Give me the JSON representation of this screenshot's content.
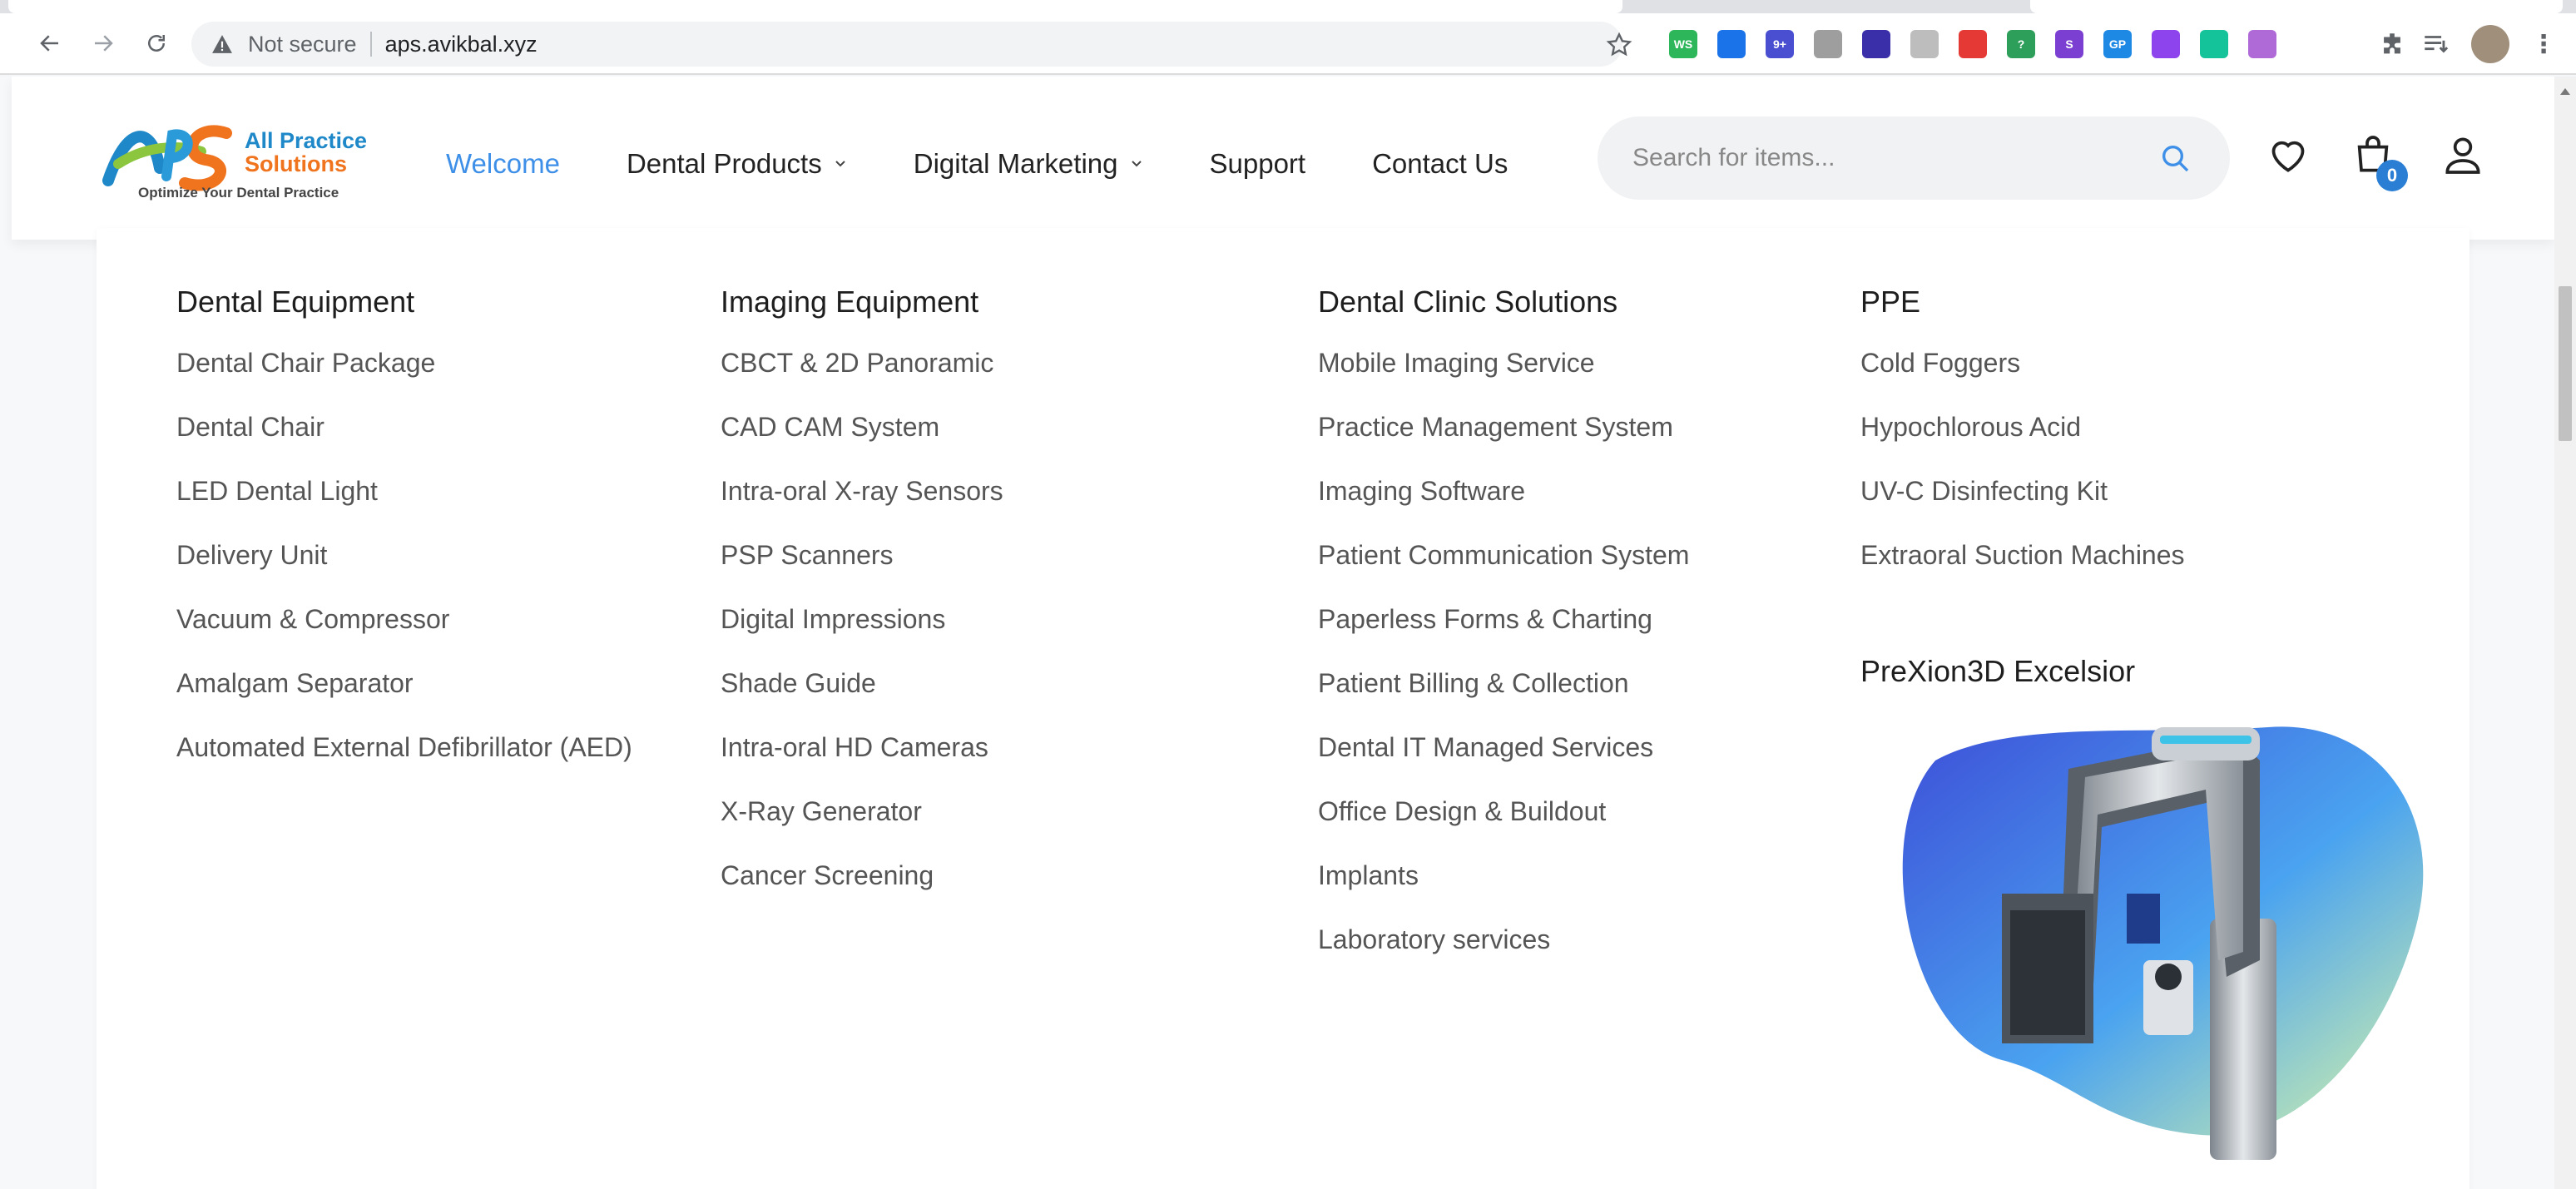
{
  "browser": {
    "security_label": "Not secure",
    "url": "aps.avikbal.xyz",
    "extensions": [
      {
        "name": "ws-extension",
        "label": "WS",
        "color": "#2eb65a"
      },
      {
        "name": "check-extension",
        "label": "",
        "color": "#1a73e8"
      },
      {
        "name": "badge-extension",
        "label": "9+",
        "color": "#4a4fd1"
      },
      {
        "name": "grey-extension",
        "label": "",
        "color": "#9e9e9e"
      },
      {
        "name": "s-extension",
        "label": "",
        "color": "#3a2fa8"
      },
      {
        "name": "grey2-extension",
        "label": "",
        "color": "#bdbdbd"
      },
      {
        "name": "o-extension",
        "label": "",
        "color": "#e53935"
      },
      {
        "name": "puzzle-badge-extension",
        "label": "?",
        "color": "#2e9e5b"
      },
      {
        "name": "s-purple-extension",
        "label": "S",
        "color": "#7b3fd1"
      },
      {
        "name": "gp-extension",
        "label": "GP",
        "color": "#1e88e5"
      },
      {
        "name": "tick-extension",
        "label": "",
        "color": "#8e44ec"
      },
      {
        "name": "grammarly-extension",
        "label": "",
        "color": "#15c39a"
      },
      {
        "name": "pen-extension",
        "label": "",
        "color": "#b06ad8"
      }
    ]
  },
  "brand": {
    "name_line1": "All Practice",
    "name_line2": "Solutions",
    "tagline": "Optimize Your Dental Practice",
    "primary_color": "#1e88c8",
    "secondary_color": "#f0731e"
  },
  "nav": {
    "items": [
      {
        "label": "Welcome",
        "active": true,
        "dropdown": false
      },
      {
        "label": "Dental Products",
        "active": false,
        "dropdown": true
      },
      {
        "label": "Digital Marketing",
        "active": false,
        "dropdown": true
      },
      {
        "label": "Support",
        "active": false,
        "dropdown": false
      },
      {
        "label": "Contact Us",
        "active": false,
        "dropdown": false
      }
    ]
  },
  "search": {
    "placeholder": "Search for items..."
  },
  "cart": {
    "count": "0"
  },
  "mega_menu": {
    "columns": [
      {
        "title": "Dental Equipment",
        "items": [
          "Dental Chair Package",
          "Dental Chair",
          "LED Dental Light",
          "Delivery Unit",
          "Vacuum & Compressor",
          "Amalgam Separator",
          "Automated External Defibrillator (AED)"
        ]
      },
      {
        "title": "Imaging Equipment",
        "items": [
          "CBCT & 2D Panoramic",
          "CAD CAM System",
          "Intra-oral X-ray Sensors",
          "PSP Scanners",
          "Digital Impressions",
          "Shade Guide",
          "Intra-oral HD Cameras",
          "X-Ray Generator",
          "Cancer Screening"
        ]
      },
      {
        "title": "Dental Clinic Solutions",
        "items": [
          "Mobile Imaging Service",
          "Practice Management System",
          "Imaging Software",
          "Patient Communication System",
          "Paperless Forms & Charting",
          "Patient Billing & Collection",
          "Dental IT Managed Services",
          "Office Design & Buildout",
          "Implants",
          "Laboratory services"
        ]
      },
      {
        "title": "PPE",
        "items": [
          "Cold Foggers",
          "Hypochlorous Acid",
          "UV-C Disinfecting Kit",
          "Extraoral Suction Machines"
        ]
      }
    ],
    "feature": {
      "title": "PreXion3D Excelsior"
    }
  }
}
